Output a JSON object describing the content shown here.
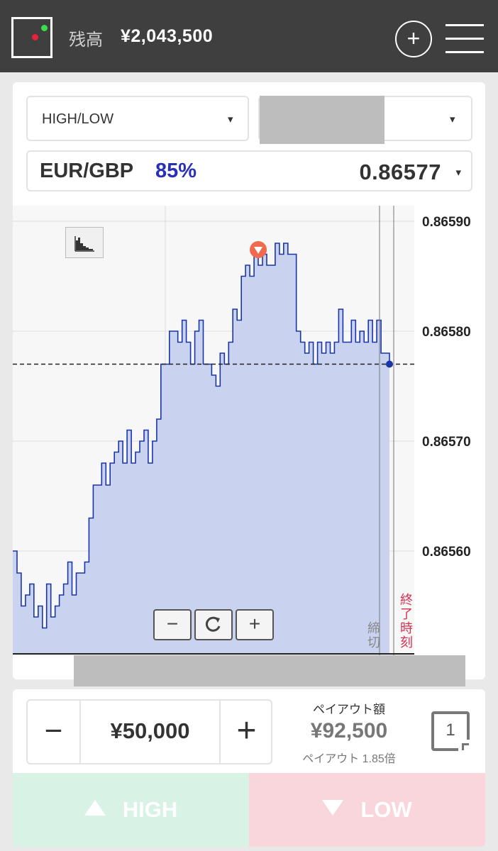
{
  "header": {
    "balance_label": "残高",
    "balance_value": "¥2,043,500",
    "logo_icon": "app-logo-icon",
    "add_icon": "plus-circle-icon",
    "menu_icon": "hamburger-menu-icon",
    "colors": {
      "bar": "#3f3f3f",
      "logo_green": "#3ddc4c",
      "logo_red": "#e8223a"
    }
  },
  "selectors": {
    "trade_type": "HIGH/LOW",
    "caret": "▾"
  },
  "asset": {
    "pair": "EUR/GBP",
    "payout_pct": "85%",
    "price": "0.86577",
    "caret": "▾"
  },
  "chart": {
    "deadline_label": "締切",
    "end_label": "終了時刻",
    "zoom_out": "−",
    "refresh_icon": "refresh-icon",
    "zoom_in": "+",
    "chart_type_icon": "area-chart-icon",
    "marker_icon": "down-arrow-marker-icon"
  },
  "chart_data": {
    "type": "area",
    "title": "",
    "xlabel": "",
    "ylabel": "",
    "ylim": [
      0.86551,
      0.86592
    ],
    "yticks": [
      "0.86590",
      "0.86580",
      "0.86570",
      "0.86560"
    ],
    "ytick_values": [
      0.8659,
      0.8658,
      0.8657,
      0.8656
    ],
    "reference_price": 0.86577,
    "current_price": 0.86577,
    "series": [
      {
        "values": [
          0.8656,
          0.86558,
          0.86555,
          0.86556,
          0.86557,
          0.86554,
          0.86555,
          0.86553,
          0.86557,
          0.86554,
          0.86555,
          0.86556,
          0.86557,
          0.86559,
          0.86556,
          0.86558,
          0.86558,
          0.86559,
          0.86563,
          0.86566,
          0.86566,
          0.86568,
          0.86566,
          0.86568,
          0.86569,
          0.8657,
          0.86568,
          0.86571,
          0.86568,
          0.86569,
          0.8657,
          0.86571,
          0.86568,
          0.8657,
          0.86572,
          0.86577,
          0.86577,
          0.8658,
          0.8658,
          0.86579,
          0.86581,
          0.86579,
          0.86577,
          0.8658,
          0.86581,
          0.86577,
          0.86577,
          0.86576,
          0.86575,
          0.86578,
          0.86577,
          0.86579,
          0.86582,
          0.86581,
          0.86585,
          0.86586,
          0.86585,
          0.86587,
          0.86586,
          0.86587,
          0.86586,
          0.86586,
          0.86588,
          0.86587,
          0.86588,
          0.86587,
          0.86587,
          0.8658,
          0.86579,
          0.86578,
          0.86579,
          0.86577,
          0.86579,
          0.86578,
          0.86579,
          0.86578,
          0.86579,
          0.86582,
          0.86579,
          0.86579,
          0.86581,
          0.86579,
          0.8658,
          0.86579,
          0.86581,
          0.86579,
          0.86581,
          0.86578,
          0.86578,
          0.86577
        ]
      }
    ],
    "entry_marker_index": 58,
    "colors": {
      "line": "#1a35a8",
      "fill": "#c9d3ef",
      "marker": "#ef6a4f"
    }
  },
  "trade": {
    "minus": "−",
    "plus": "+",
    "amount": "¥50,000",
    "payout_label": "ペイアウト額",
    "payout_value": "¥92,500",
    "payout_multiplier": "ペイアウト 1.85倍",
    "counter": "1",
    "high_label": "HIGH",
    "low_label": "LOW",
    "colors": {
      "high": "#d9f2e6",
      "low": "#f9d6dc"
    }
  }
}
